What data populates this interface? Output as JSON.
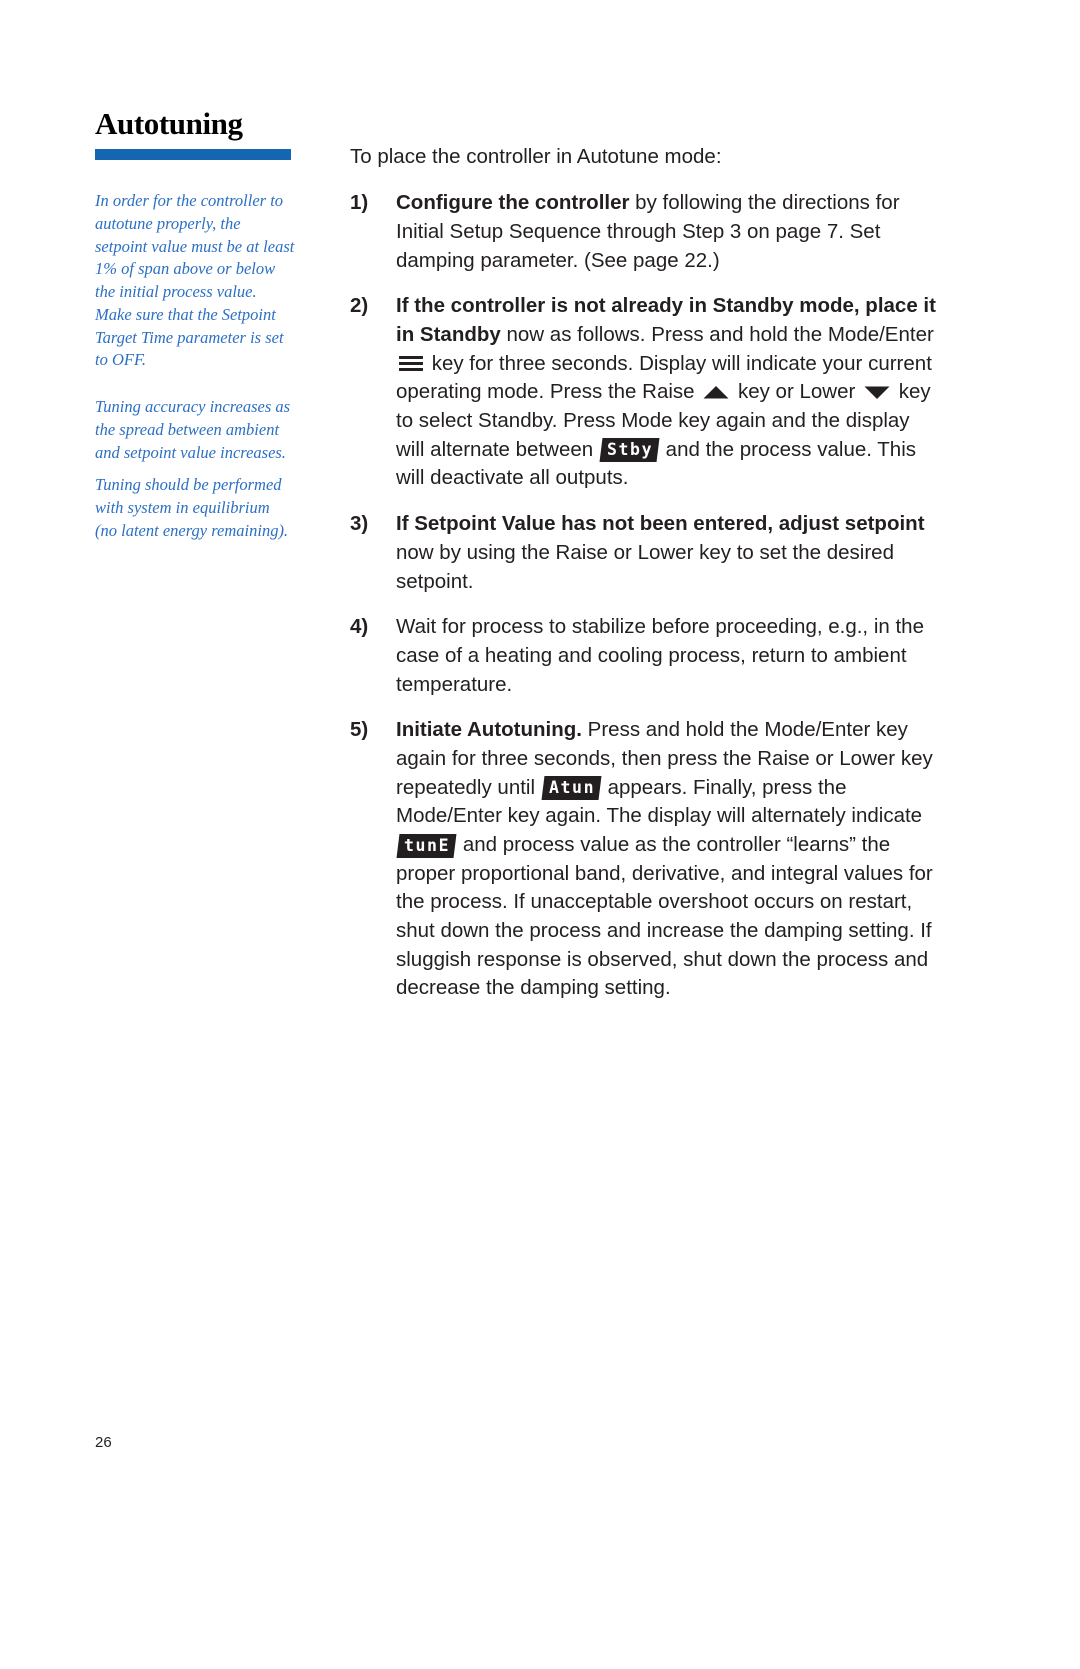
{
  "document": {
    "chapter_title": "Autotuning",
    "page_number": "26",
    "accent_color": "#1566b0",
    "note_color": "#2b6fc4",
    "text_color": "#231f20"
  },
  "sidebar": {
    "notes": [
      "In order for the controller to autotune properly, the setpoint value must be at least 1% of span above or below the initial process value. Make sure that the Setpoint Target Time parameter is set to OFF.",
      "Tuning accuracy increases as the spread between ambient and setpoint value increases.",
      "Tuning should be performed with system in equilibrium (no latent energy remaining)."
    ]
  },
  "main": {
    "lead": "To place the controller in Autotune mode:",
    "steps": [
      {
        "number": "1)",
        "bold_lead": "Configure the controller",
        "text": " by following the directions for Initial Setup Sequence through Step 3 on page 7. Set damping parameter. (See page 22.)"
      },
      {
        "number": "2)",
        "bold_lead": "If the controller is not already in Standby mode, place it in Standby",
        "text_a": " now as follows. Press and hold the Mode/Enter ",
        "icon_mode": "mode-enter-key-icon",
        "text_b": " key for three seconds. Display will indicate your current operating mode. Press the Raise ",
        "icon_raise": "raise-key-icon",
        "text_c": " key or Lower ",
        "icon_lower": "lower-key-icon",
        "text_d": " key to select Standby. Press Mode key again and the display will alternate between ",
        "led_standby": "Stby",
        "text_e": " and the process value. This will deactivate all outputs."
      },
      {
        "number": "3)",
        "bold_lead": "If Setpoint Value has not been entered, adjust setpoint",
        "text": " now by using the Raise or Lower key to set the desired setpoint."
      },
      {
        "number": "4)",
        "bold_lead": "",
        "text": "Wait for process to stabilize before proceeding, e.g., in the case of a heating and cooling process, return to ambient temperature."
      },
      {
        "number": "5)",
        "bold_lead": "Initiate Autotuning.",
        "text_a": " Press and hold the Mode/Enter key again for three seconds, then press the Raise or Lower key repeatedly until ",
        "led_atun": "Atun",
        "text_b": " appears. Finally, press the Mode/Enter key again. The display will alternately indicate ",
        "led_tune": "tunE",
        "text_c": " and process value as the controller “learns” the proper proportional band, derivative, and integral values for the process. If unacceptable overshoot occurs on restart, shut down the process and increase the damping setting. If sluggish response is observed, shut down the process and decrease the damping setting."
      }
    ]
  }
}
